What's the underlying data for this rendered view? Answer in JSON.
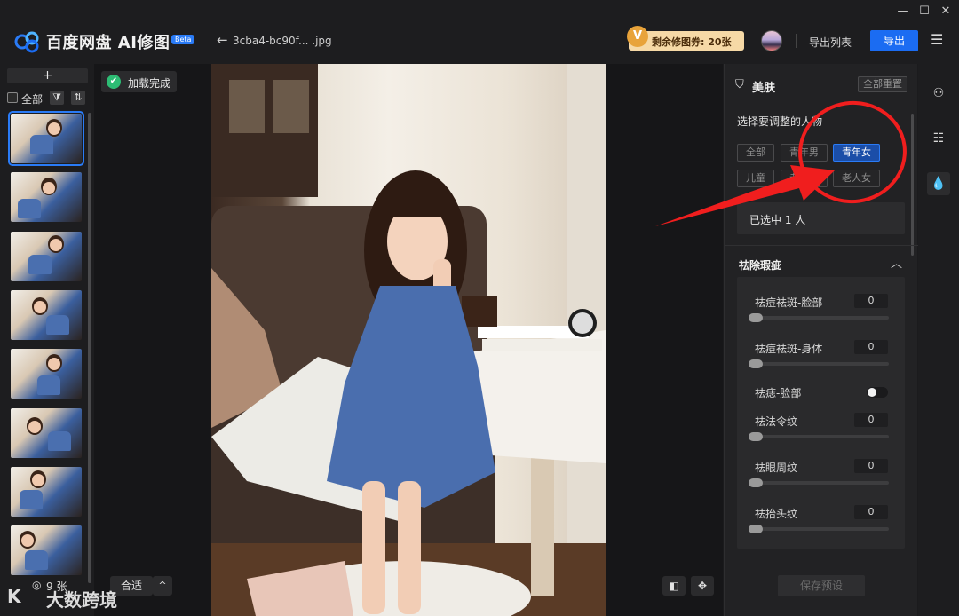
{
  "app": {
    "title": "百度网盘 AI修图",
    "beta_badge": "Beta",
    "file_name": "3cba4-bc90f... .jpg",
    "coupon_icon_letter": "V",
    "coupon_text": "剩余修图券: 20张",
    "export_list_label": "导出列表",
    "export_label": "导出",
    "window_controls": [
      "—",
      "☐",
      "✕"
    ]
  },
  "left_panel": {
    "add_label": "+",
    "select_all_label": "全部",
    "filter_icon": "filter-icon",
    "sort_icon": "sort-icon",
    "thumbnails_count": 8,
    "count_label": "9 张"
  },
  "canvas": {
    "loaded_label": "加载完成",
    "fit_label": "合适",
    "fit_arrow": "^",
    "compare_icon": "compare-icon",
    "pan_icon": "pan-icon"
  },
  "right_panel": {
    "title": "美肤",
    "reset_all_label": "全部重置",
    "person_prompt": "选择要调整的人物",
    "person_chips": [
      {
        "label": "全部",
        "active": false
      },
      {
        "label": "青年男",
        "active": false
      },
      {
        "label": "青年女",
        "active": true
      },
      {
        "label": "儿童",
        "active": false
      },
      {
        "label": "老人男",
        "active": false
      },
      {
        "label": "老人女",
        "active": false
      }
    ],
    "selected_text": "已选中 1 人",
    "section_title": "祛除瑕疵",
    "sliders": [
      {
        "label": "祛痘祛斑-脸部",
        "value": "0"
      },
      {
        "label": "祛痘祛斑-身体",
        "value": "0"
      },
      {
        "label": "祛痣-脸部",
        "toggle": true
      },
      {
        "label": "祛法令纹",
        "value": "0"
      },
      {
        "label": "祛眼周纹",
        "value": "0"
      },
      {
        "label": "祛抬头纹",
        "value": "0"
      }
    ],
    "save_preset_label": "保存预设"
  },
  "tool_strip": {
    "tools": [
      "color-circles-icon",
      "adjust-sliders-icon",
      "skin-drop-icon"
    ]
  },
  "watermark": {
    "logo": "K",
    "text": "大数跨境"
  },
  "colors": {
    "accent": "#1b6cf2",
    "annotation": "#f01e1e",
    "coupon_bg": "#f6d9a6"
  }
}
